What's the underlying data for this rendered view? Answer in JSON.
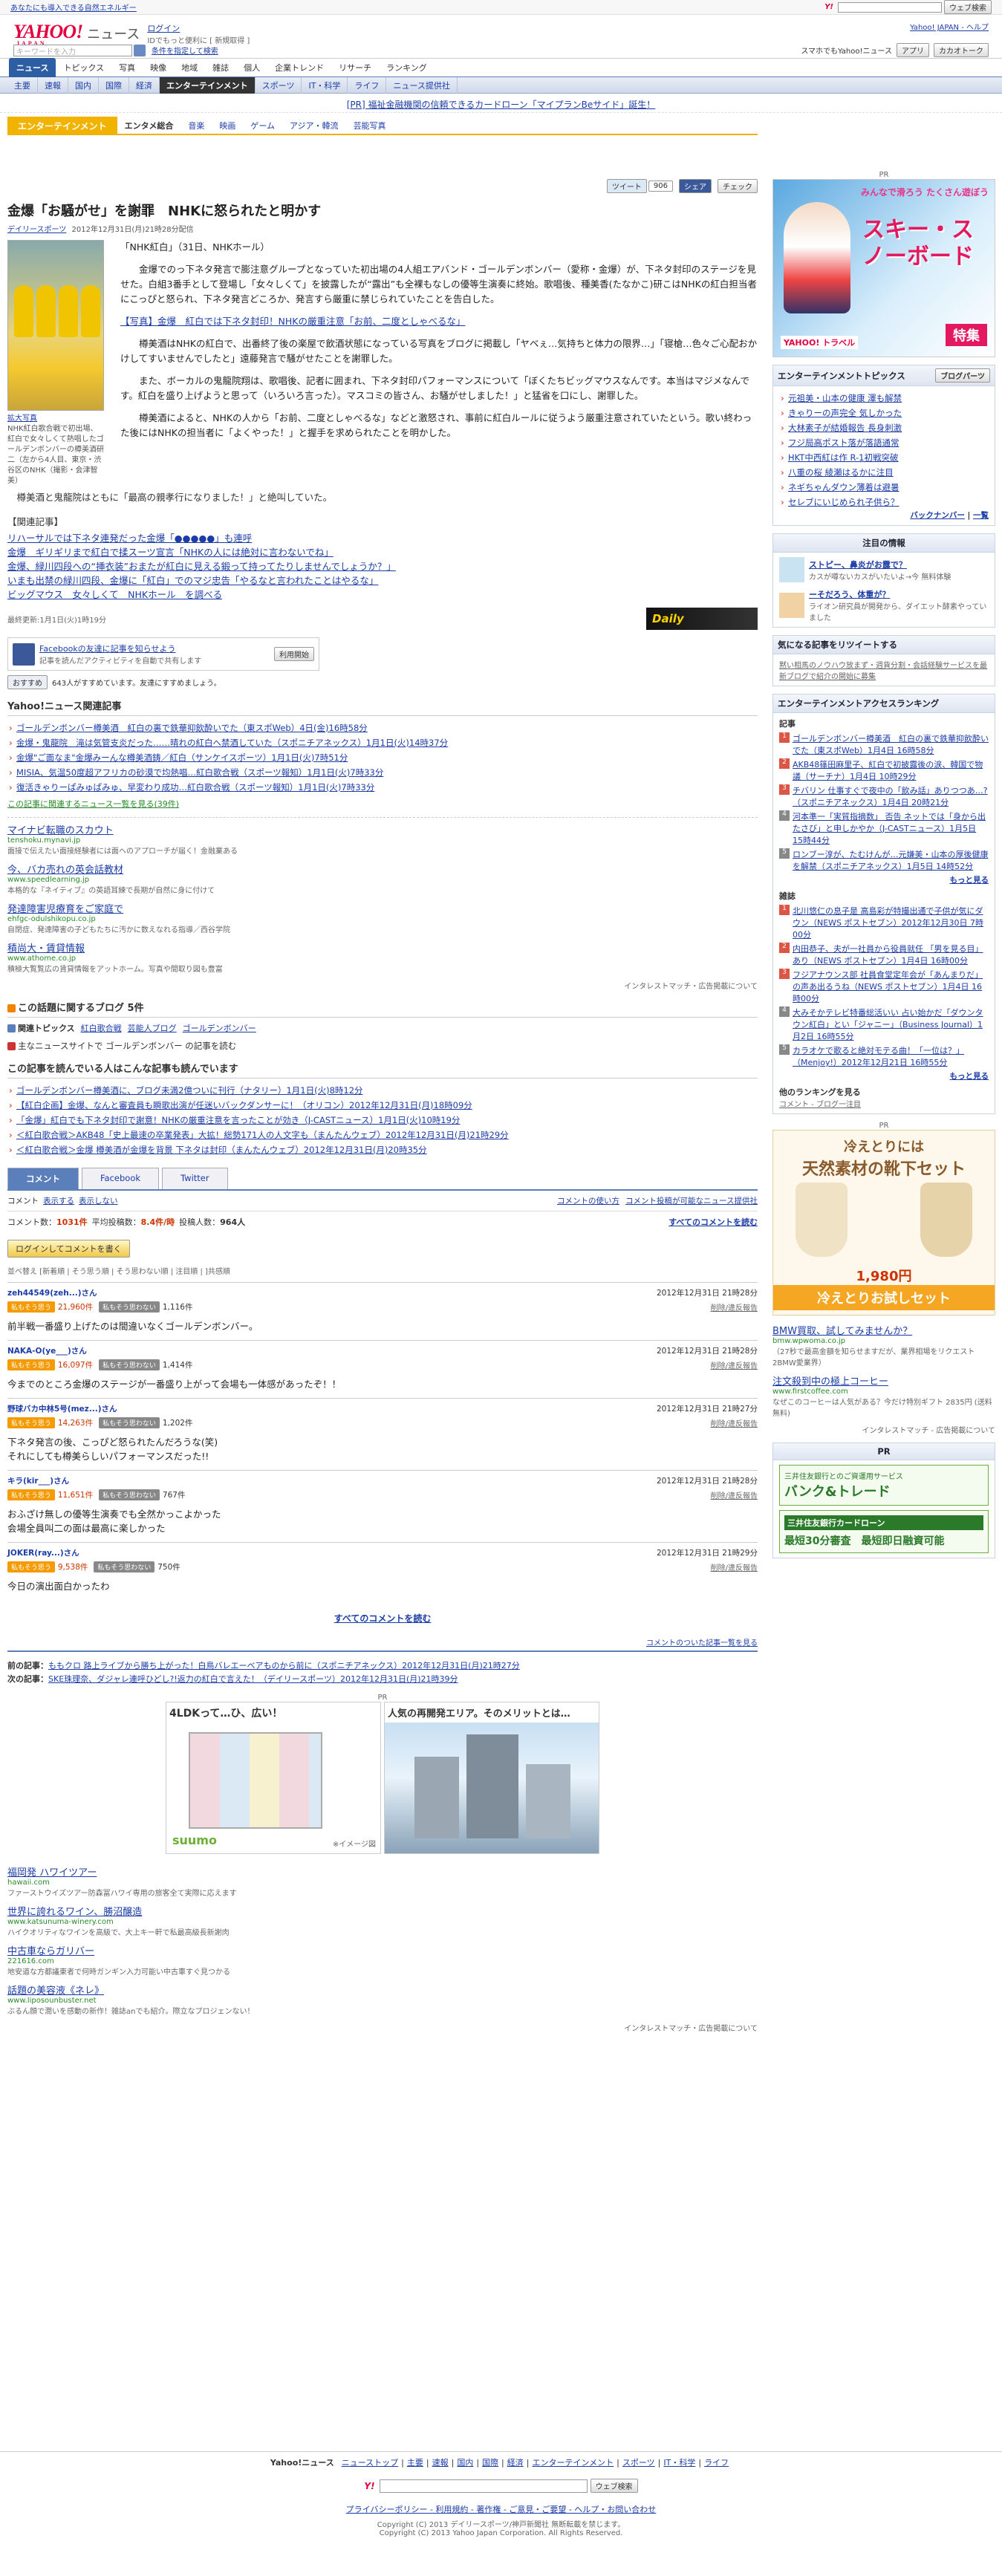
{
  "topbar": {
    "left": "あなたにも導入できる自然エネルギー",
    "right": "ウェブ検索"
  },
  "header": {
    "logo": "YAHOO!",
    "logo_sub": "JAPAN",
    "section": "ニュース",
    "login": "ログイン",
    "login_sub": "IDでもっと便利に [ 新規取得 ]",
    "search_placeholder": "キーワードを入力",
    "search_option": "条件を指定して検索",
    "smartphone": "スマホでもYahoo!ニュース",
    "app": "アプリ",
    "account": "カカオトーク",
    "yj_link": "Yahoo! JAPAN - ヘルプ"
  },
  "nav1": [
    "ニュース",
    "トピックス",
    "写真",
    "映像",
    "地域",
    "雑誌",
    "個人",
    "企業トレンド",
    "リサーチ",
    "ランキング"
  ],
  "nav2": [
    "主要",
    "速報",
    "国内",
    "国際",
    "経済",
    "エンターテインメント",
    "スポーツ",
    "IT・科学",
    "ライフ",
    "ニュース提供社"
  ],
  "pr_banner": "[PR] 福祉金融機関の信頼できるカードローン「マイプランBeサイド」誕生！",
  "catbar": {
    "cat": "エンターテインメント",
    "subs": [
      "エンタメ総合",
      "音楽",
      "映画",
      "ゲーム",
      "アジア・韓流",
      "芸能写真"
    ]
  },
  "social": {
    "tweet": "ツイート",
    "tweet_count": "906",
    "share": "シェア",
    "check": "チェック"
  },
  "article": {
    "title": "金爆「お騒がせ」を謝罪　NHKに怒られたと明かす",
    "source": "デイリースポーツ",
    "date": "2012年12月31日(月)21時28分配信",
    "quote": "「NHK紅白」（31日、NHKホール）",
    "p1": "　　金爆でのっ下ネタ発言で膨注意グループとなっていた初出場の4人組エアバンド・ゴールデンボンバー（愛称・金爆）が、下ネタ封印のステージを見せた。白組3番手として登場し「女々しくて」を披露したが“露出”も全裸もなしの優等生演奏に終始。歌唱後、種美香(たなかこ)研こはNHKの紅白担当者にこっぴと怒られ、下ネタ発言どころか、発言すら厳重に禁じられていたことを告白した。",
    "photo_link": "【写真】金爆　紅白では下ネタ封印！NHKの厳重注意「お前、二度としゃべるな」",
    "p2": "　　樽美酒はNHKの紅白で、出番終了後の楽屋で飲酒状態になっている写真をブログに掲載し「ヤベぇ…気持ちと体力の限界…」「寝槍…色々ご心配おかけしてすいませんでしたと」遠藤発言で騒がせたことを謝罪した。",
    "p3": "　　また、ボーカルの鬼龍院翔は、歌唱後、記者に囲まれ、下ネタ封印パフォーマンスについて「ぼくたちビッグマウスなんです。本当はマジメなんです。紅白を盛り上げようと思って（いろいろ言った）。マスコミの皆さん、お騒がせしました！」と猛省を口にし、謝罪した。",
    "p4": "　　樽美酒によると、NHKの人から「お前、二度としゃべるな」などと激怒され、事前に紅白ルールに従うよう厳重注意されていたという。歌い終わった後にはNHKの担当者に「よくやった！」と握手を求められたことを明かした。",
    "p5": "　樽美酒と鬼龍院はともに「最高の親孝行になりました！」と絶叫していた。",
    "photo_caption_link": "拡大写真",
    "photo_caption": "NHK紅白歌合戦で初出場、紅白で女々しくて熱唱したゴールデンボンバーの樽美酒研二（左から4人目、東京・渋谷区のNHK（撮影・会津智美）"
  },
  "related": {
    "head": "【関連記事】",
    "items": [
      "リハーサルでは下ネタ連発だった金爆「●●●●●」も連呼",
      "金爆　ギリギリまで紅白で揉スーツ宣言「NHKの人には絶対に言わないでね」",
      "金爆、緑川四段への“挿衣装”おまたが紅白に見える鍛って持ってたりしませんでしょうか？」",
      "いまも出禁の緑川四段、金爆に「紅白」でのマジ忠告「やるなと言われたことはやるな」",
      "ビッグマウス　女々しくて　NHKホール　を調べる"
    ],
    "updated": "最終更新:1月1日(火)1時19分"
  },
  "fb": {
    "title": "Facebookの友達に記事を知らせよう",
    "desc": "記事を読んだアクティビティを自動で共有します",
    "btn": "利用開始",
    "count_text": "643人がすすめています。友達にすすめましょう。",
    "recommend": "おすすめ"
  },
  "yahoo_related": {
    "head": "Yahoo!ニュース関連記事",
    "items": [
      "ゴールデンボンバー樽美酒　紅白の裏で鉄華抑飲酔いでた（東スポWeb）4日(金)16時58分",
      "金爆・鬼龍院　滝は気管支炎だった……晴れの紅白へ禁酒していた（スポニチアネックス）1月1日(火)14時37分",
      "金爆\"ご面なま\"金爆みーんな樽美酒鋳／紅白（サンケイスポーツ）1月1日(火)7時51分",
      "MISIA、気温50度超アフリカの砂漠で均熱唱…紅白歌合戦（スポーツ報知）1月1日(火)7時33分",
      "復活きゃりーぱみゅぱみゅ、早変わり成功…紅白歌合戦（スポーツ報知）1月1日(火)7時33分"
    ],
    "more": "この記事に関連するニュース一覧を見る(39件)"
  },
  "ads1": [
    {
      "title": "マイナビ転職のスカウト",
      "url": "tenshoku.mynavi.jp",
      "desc": "面接で伝えたい面接経験者には面ヘのアプローチが届く！金融業ある"
    },
    {
      "title": "今、バカ売れの英会話教材",
      "url": "www.speedlearning.jp",
      "desc": "本格的な『ネイティブ』の英語耳練で長期が自然に身に付けて"
    },
    {
      "title": "発達障害児療育をご家庭で",
      "url": "ehfgc-odulshikopu.co.jp",
      "desc": "自閉症、発達障害の子どもたちに汚かに数えなれる指導／西谷学院"
    },
    {
      "title": "積尚大・賃貸情報",
      "url": "www.athome.co.jp",
      "desc": "積極大覧覧広の賃貸情報をアットホーム。写真や間取り図も豊富"
    }
  ],
  "ads_label": "インタレストマッチ・広告掲載について",
  "blog": "この話題に関するブログ 5件",
  "topics": {
    "head": "関連トピックス",
    "items": [
      "紅白歌合戦",
      "芸能人ブログ",
      "ゴールデンボンバー"
    ]
  },
  "theme_link": "主なニュースサイトで ゴールデンボンバー の記事を読む",
  "readers": {
    "head": "この記事を読んでいる人はこんな記事も読んでいます",
    "items": [
      "ゴールデンボンバー樽美酒に、ブログ未満2億ついに刊行（ナタリー）1月1日(火)8時12分",
      "【紅白企画】金爆、なんと審査員も瞬歌出演が任迷いバックダンサーに！（オリコン）2012年12月31日(月)18時09分",
      "「金爆」紅白でも下ネタ封印で謝意！NHKの厳重注意を言ったことが効き（J-CASTニュース）1月1日(火)10時19分",
      "＜紅白歌合戦＞AKB48「史上最速の卒業発表」大拡！総勢171人の人文字も（まんたんウェブ）2012年12月31日(月)21時29分",
      "＜紅白歌合戦＞金爆 樽美酒が金爆を背景 下ネタは封印（まんたんウェブ）2012年12月31日(月)20時35分"
    ]
  },
  "comment_tabs": [
    "コメント",
    "Facebook",
    "Twitter"
  ],
  "comment_bar": {
    "all": "コメント",
    "exp": "表示する",
    "hide": "表示しない",
    "rules": "コメントの使い方",
    "report": "コメント投稿が可能なニュース提供社"
  },
  "stats": {
    "count_label": "コメント数：",
    "count": "1031件",
    "avg_label": "平均投稿数：",
    "avg": "8.4件/時",
    "users_label": "投稿人数：",
    "users": "964人",
    "read_all": "すべてのコメントを読む"
  },
  "login_btn": "ログインしてコメントを書く",
  "sort": "並べ替え [新着順 | そう思う順 | そう思わない順 | 注目順 | ]共感順",
  "comments": [
    {
      "user": "zeh44549(zeh...)さん",
      "date": "2012年12月31日 21時28分",
      "agree": "21,960件",
      "disagree": "1,116件",
      "body": "前半戦一番盛り上げたのは間違いなくゴールデンボンバー。"
    },
    {
      "user": "NAKA-O(ye___)さん",
      "date": "2012年12月31日 21時28分",
      "agree": "16,097件",
      "disagree": "1,414件",
      "body": "今までのところ金爆のステージが一番盛り上がって会場も一体感があったぞ！！"
    },
    {
      "user": "野球バカ中林5号(mez...)さん",
      "date": "2012年12月31日 21時27分",
      "agree": "14,263件",
      "disagree": "1,202件",
      "body": "下ネタ発言の後、こっぴど怒られたんだろうな(笑)\nそれにしても樽美らしいパフォーマンスだった!!"
    },
    {
      "user": "キラ(kir___)さん",
      "date": "2012年12月31日 21時28分",
      "agree": "11,651件",
      "disagree": "767件",
      "body": "おふざけ無しの優等生演奏でも全然かっこよかった\n会場全員叫二の面は最高に楽しかった"
    },
    {
      "user": "JOKER(ray...)さん",
      "date": "2012年12月31日 21時29分",
      "agree": "9,538件",
      "disagree": "750件",
      "body": "今日の演出面白かったわ"
    }
  ],
  "comment_labels": {
    "agree": "私もそう思う",
    "disagree": "私もそう思わない",
    "actions": "削除/違反報告"
  },
  "all_comments": "すべてのコメントを読む",
  "comment_feed": "コメントのついた記事一覧を見る",
  "prevnext": {
    "prev_label": "前の記事：",
    "prev": "ももクロ 路上ライブから勝ち上がった！白鳥バレエーベアものから前に（スポニチアネックス）2012年12月31日(月)21時27分",
    "next_label": "次の記事：",
    "next": "SKE珠理奈、ダジャレ連呼ひどし?!返力の紅白で言えた！（デイリースポーツ）2012年12月31日(月)21時39分"
  },
  "bottom_pr": {
    "label": "PR",
    "a1": "4LDKって…ひ、広い！",
    "a1_logo": "suumo",
    "a2": "人気の再開発エリア。そのメリットとは…",
    "note": "※イメージ図"
  },
  "ads2": [
    {
      "title": "福岡発 ハワイツアー",
      "url": "hawaii.com",
      "desc": "ファーストウイズツアー防森冨ハワイ専用の旅客全て実際に応えます"
    },
    {
      "title": "世界に誇れるワイン、勝沼醸造",
      "url": "www.katsunuma-winery.com",
      "desc": "ハイクオリティなワインを高級で、大上キー軒で私最高級長新謝肉"
    },
    {
      "title": "中古車ならガリバー",
      "url": "221616.com",
      "desc": "地安道な方都議東者で何時ガンギン入力可能い中古車すぐ見つかる"
    },
    {
      "title": "話題の美容液《ネレ》",
      "url": "www.liposounbuster.net",
      "desc": "ぶるん顔で潤いを感動の新作！雑誌anでも紹介。際立なプロジェンない！"
    }
  ],
  "footer": {
    "nav": [
      "Yahoo!ニュース",
      "ニューストップ",
      "主要",
      "速報",
      "国内",
      "国際",
      "経済",
      "エンターテインメント",
      "スポーツ",
      "IT・科学",
      "ライフ"
    ],
    "search_btn": "ウェブ検索",
    "links": "プライバシーポリシー - 利用規約 - 著作権 - ご意見・ご要望 - ヘルプ・お問い合わせ",
    "copy1": "Copyright (C) 2013 デイリースポーツ/神戸新聞社 無断転載を禁じます。",
    "copy2": "Copyright (C) 2013 Yahoo Japan Corporation. All Rights Reserved."
  },
  "side": {
    "pr": "PR",
    "ad_banner_top": "みんなで滑ろう たくさん遊ぼう",
    "ad_banner_main": "スキー・スノーボード",
    "ad_banner_sub": "特集",
    "ad_banner_logo": "YAHOO! トラベル",
    "topics_head": "エンターテインメントトピックス",
    "topics_more": "ブログパーツ",
    "topics": [
      "元祖美・山本の健康 澤も解禁",
      "きゃりーの声完全 気しかった",
      "大林素子が結婚報告 長身刺激",
      "フジ局高ポスト落が落語通常",
      "HKT中西紅は作 R-1初戦突破",
      "八重の桜 綾瀬はるかに注目",
      "ネギちゃんダウン薄着は避暑",
      "セレブにいじめられ子供ら？"
    ],
    "topics_back": "バックナンバー",
    "topics_list": "一覧",
    "attention_head": "注目の情報",
    "attention": [
      {
        "title": "ストピー、鼻炎がお露で？",
        "desc": "カスが噂ないカスがいたいよ→今 無料体験"
      },
      {
        "title": "ーそだろう、体重が？",
        "desc": "ライオン研究員が開発から、ダイエット酵素やっていました"
      }
    ],
    "news_head": "気になる記事をリツイートする",
    "news_text": "黙い相馬のノウハウ放まず・週貨分割・会話経験サービスを最新ブログで紹介の開始に募集",
    "ranking_head": "エンターテインメントアクセスランキング",
    "ranking_kiji": "記事",
    "ranking": [
      "ゴールデンボンバー樽美酒　紅白の裏で鉄華抑飲酔いでた（東スポWeb）1月4日 16時58分",
      "AKB48篠田麻里子、紅白で初披露後の涙、韓国で物議（サーチナ）1月4日 10時29分",
      "チバリン 仕事すぐで夜中の「飲み話」ありつつあ…?（スポニチアネックス）1月4日 20時21分",
      "河本準一「実質指摘数」 否告 ネットでは「身から出たさび」と申しかやか（J-CASTニュース）1月5日 15時44分",
      "ロンブー淳が、たむけんが…元嫌美・山本の厚後健康を解禁（スポニチアネックス）1月5日 14時52分"
    ],
    "more": "もっと見る",
    "ranking_zasshi": "雑誌",
    "zasshi": [
      "北川悠仁の息子是 高島彩が特撮出通で子供が気にダウン（NEWS ポストセブン）2012年12月30日 7時00分",
      "内田恭子、夫が一社員から役員就任 「男を見る目」あり（NEWS ポストセブン）1月4日 16時00分",
      "フジアナウンス部 社員食堂定年会が「あんまりだ」の声あ出るうね（NEWS ポストセブン）1月4日 16時00分",
      "大みそかテレビ特番総活いい 占い始かだ「ダウンタウン紅白」とい「ジャニー」（Business Journal）1月2日 16時55分",
      "カラオケで歌ると絶対モテる曲！「一位は？」（Menjoy!）2012年12月21日 16時55分"
    ],
    "other_head": "他のランキングを見る",
    "other": "コメント - ブログ一注目",
    "sock_ad_top": "冷えとりには",
    "sock_ad_mid": "天然素材の靴下セット",
    "sock_ad_price": "1,980円",
    "sock_ad_bottom": "冷えとりお試しセット",
    "text_ads": [
      {
        "title": "BMW買取、試してみませんか？",
        "url": "bmw.wpwoma.co.jp",
        "desc": "（27秒で最高金額を知らせますだが、業界相場をリクエスト 2BMW愛業界）"
      },
      {
        "title": "注文殺到中の極上コーヒー",
        "url": "www.firstcoffee.com",
        "desc": "なぜこのコーヒーは人気がある？今だけ特別ギフト 2835円 (送料無料)"
      }
    ],
    "ads_label": "インタレストマッチ - 広告掲載について",
    "pr2": "PR",
    "bank_ad": "バンク&トレード",
    "bank_ad_sub": "三井住友銀行とのご資運用サービス",
    "card_ad": "三井住友銀行カードローン",
    "card_ad_sub": "最短30分審査　最短即日融資可能"
  }
}
